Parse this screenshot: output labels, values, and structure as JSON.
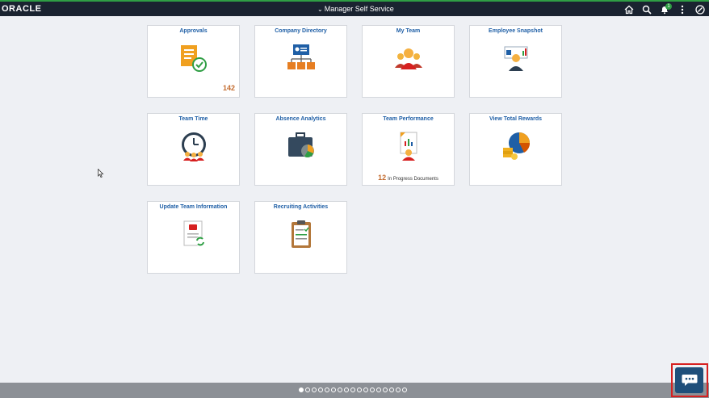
{
  "header": {
    "logo": "ORACLE",
    "title": "Manager Self Service",
    "notification_count": "1",
    "icons": [
      "home-icon",
      "search-icon",
      "notifications-icon",
      "more-actions-icon",
      "navbar-icon"
    ]
  },
  "tiles": [
    {
      "title": "Approvals",
      "icon": "approvals-icon",
      "count": "142"
    },
    {
      "title": "Company Directory",
      "icon": "org-chart-icon"
    },
    {
      "title": "My Team",
      "icon": "team-icon"
    },
    {
      "title": "Employee Snapshot",
      "icon": "employee-snapshot-icon"
    },
    {
      "title": "Team Time",
      "icon": "clock-team-icon"
    },
    {
      "title": "Absence Analytics",
      "icon": "briefcase-chart-icon"
    },
    {
      "title": "Team Performance",
      "icon": "performance-icon",
      "count": "12",
      "count_label": "In Progress Documents"
    },
    {
      "title": "View Total Rewards",
      "icon": "rewards-pie-icon"
    },
    {
      "title": "Update Team Information",
      "icon": "update-doc-icon"
    },
    {
      "title": "Recruiting Activities",
      "icon": "clipboard-icon"
    }
  ],
  "pagination": {
    "pages": 17,
    "active": 1
  },
  "chat": {
    "icon": "chat-icon"
  },
  "colors": {
    "header_bg": "#1a2330",
    "accent_green": "#2f9e44",
    "tile_title": "#1f5fa6",
    "count": "#c36a2d",
    "footer": "#8c9096",
    "highlight": "#d62020"
  }
}
